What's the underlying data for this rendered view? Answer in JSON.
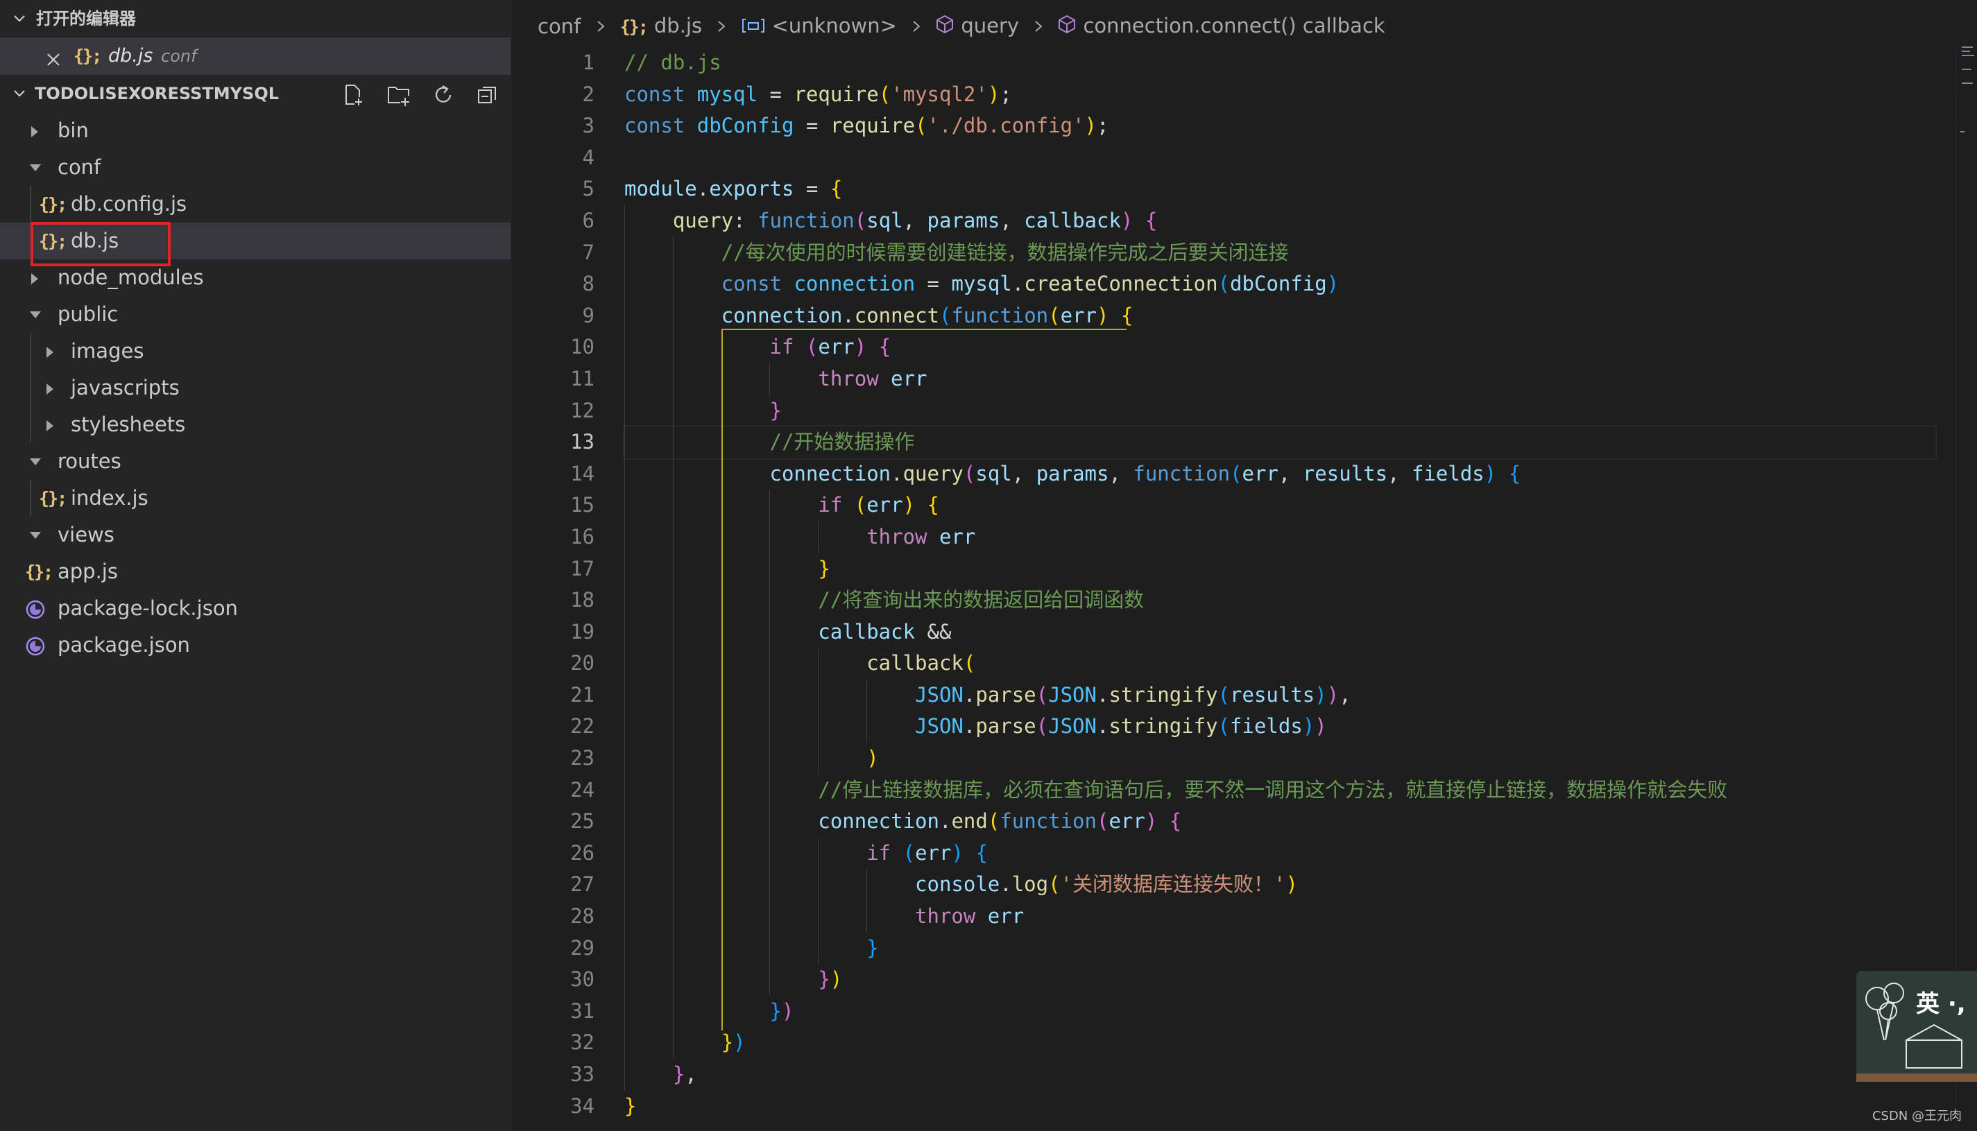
{
  "sidebar": {
    "open_editors_title": "打开的编辑器",
    "open_editor_file": "db.js",
    "open_editor_dir": "conf",
    "project_title": "TODOLISEXORESSTMYSQL",
    "tree": [
      {
        "label": "bin",
        "kind": "folder",
        "expanded": false
      },
      {
        "label": "conf",
        "kind": "folder",
        "expanded": true
      },
      {
        "label": "db.config.js",
        "kind": "js"
      },
      {
        "label": "db.js",
        "kind": "js",
        "active": true
      },
      {
        "label": "node_modules",
        "kind": "folder",
        "expanded": false
      },
      {
        "label": "public",
        "kind": "folder",
        "expanded": true
      },
      {
        "label": "images",
        "kind": "folder",
        "expanded": false
      },
      {
        "label": "javascripts",
        "kind": "folder",
        "expanded": false
      },
      {
        "label": "stylesheets",
        "kind": "folder",
        "expanded": false
      },
      {
        "label": "routes",
        "kind": "folder",
        "expanded": true
      },
      {
        "label": "index.js",
        "kind": "js"
      },
      {
        "label": "views",
        "kind": "folder",
        "expanded": true
      },
      {
        "label": "app.js",
        "kind": "js"
      },
      {
        "label": "package-lock.json",
        "kind": "json"
      },
      {
        "label": "package.json",
        "kind": "json"
      }
    ]
  },
  "breadcrumb": {
    "dir": "conf",
    "file": "db.js",
    "symbol1": "<unknown>",
    "symbol2": "query",
    "symbol3": "connection.connect() callback"
  },
  "editor": {
    "current_line": 13,
    "lines": [
      [
        [
          "com",
          "// db.js"
        ]
      ],
      [
        [
          "kw",
          "const "
        ],
        [
          "const",
          "mysql"
        ],
        [
          "txt",
          " = "
        ],
        [
          "fn",
          "require"
        ],
        [
          "b1",
          "("
        ],
        [
          "str",
          "'mysql2'"
        ],
        [
          "b1",
          ")"
        ],
        [
          "txt",
          ";"
        ]
      ],
      [
        [
          "kw",
          "const "
        ],
        [
          "const",
          "dbConfig"
        ],
        [
          "txt",
          " = "
        ],
        [
          "fn",
          "require"
        ],
        [
          "b1",
          "("
        ],
        [
          "str",
          "'./db.config'"
        ],
        [
          "b1",
          ")"
        ],
        [
          "txt",
          ";"
        ]
      ],
      [],
      [
        [
          "var",
          "module"
        ],
        [
          "txt",
          "."
        ],
        [
          "var",
          "exports"
        ],
        [
          "txt",
          " = "
        ],
        [
          "b1",
          "{"
        ]
      ],
      [
        [
          "txt",
          "    "
        ],
        [
          "fn",
          "query"
        ],
        [
          "txt",
          ": "
        ],
        [
          "kw",
          "function"
        ],
        [
          "b2",
          "("
        ],
        [
          "var",
          "sql"
        ],
        [
          "txt",
          ", "
        ],
        [
          "var",
          "params"
        ],
        [
          "txt",
          ", "
        ],
        [
          "var",
          "callback"
        ],
        [
          "b2",
          ")"
        ],
        [
          "txt",
          " "
        ],
        [
          "b2",
          "{"
        ]
      ],
      [
        [
          "txt",
          "        "
        ],
        [
          "com",
          "//每次使用的时候需要创建链接，数据操作完成之后要关闭连接"
        ]
      ],
      [
        [
          "txt",
          "        "
        ],
        [
          "kw",
          "const "
        ],
        [
          "const",
          "connection"
        ],
        [
          "txt",
          " = "
        ],
        [
          "var",
          "mysql"
        ],
        [
          "txt",
          "."
        ],
        [
          "fn",
          "createConnection"
        ],
        [
          "b3",
          "("
        ],
        [
          "var",
          "dbConfig"
        ],
        [
          "b3",
          ")"
        ]
      ],
      [
        [
          "txt",
          "        "
        ],
        [
          "var",
          "connection"
        ],
        [
          "txt",
          "."
        ],
        [
          "fn",
          "connect"
        ],
        [
          "b3",
          "("
        ],
        [
          "kw",
          "function"
        ],
        [
          "b1",
          "("
        ],
        [
          "var",
          "err"
        ],
        [
          "b1",
          ")"
        ],
        [
          "txt",
          " "
        ],
        [
          "b1",
          "{"
        ]
      ],
      [
        [
          "txt",
          "            "
        ],
        [
          "ctl",
          "if "
        ],
        [
          "b2",
          "("
        ],
        [
          "var",
          "err"
        ],
        [
          "b2",
          ")"
        ],
        [
          "txt",
          " "
        ],
        [
          "b2",
          "{"
        ]
      ],
      [
        [
          "txt",
          "                "
        ],
        [
          "ctl",
          "throw "
        ],
        [
          "var",
          "err"
        ]
      ],
      [
        [
          "txt",
          "            "
        ],
        [
          "b2",
          "}"
        ]
      ],
      [
        [
          "txt",
          "            "
        ],
        [
          "com",
          "//开始数据操作"
        ]
      ],
      [
        [
          "txt",
          "            "
        ],
        [
          "var",
          "connection"
        ],
        [
          "txt",
          "."
        ],
        [
          "fn",
          "query"
        ],
        [
          "b2",
          "("
        ],
        [
          "var",
          "sql"
        ],
        [
          "txt",
          ", "
        ],
        [
          "var",
          "params"
        ],
        [
          "txt",
          ", "
        ],
        [
          "kw",
          "function"
        ],
        [
          "b3",
          "("
        ],
        [
          "var",
          "err"
        ],
        [
          "txt",
          ", "
        ],
        [
          "var",
          "results"
        ],
        [
          "txt",
          ", "
        ],
        [
          "var",
          "fields"
        ],
        [
          "b3",
          ")"
        ],
        [
          "txt",
          " "
        ],
        [
          "b3",
          "{"
        ]
      ],
      [
        [
          "txt",
          "                "
        ],
        [
          "ctl",
          "if "
        ],
        [
          "b1",
          "("
        ],
        [
          "var",
          "err"
        ],
        [
          "b1",
          ")"
        ],
        [
          "txt",
          " "
        ],
        [
          "b1",
          "{"
        ]
      ],
      [
        [
          "txt",
          "                    "
        ],
        [
          "ctl",
          "throw "
        ],
        [
          "var",
          "err"
        ]
      ],
      [
        [
          "txt",
          "                "
        ],
        [
          "b1",
          "}"
        ]
      ],
      [
        [
          "txt",
          "                "
        ],
        [
          "com",
          "//将查询出来的数据返回给回调函数"
        ]
      ],
      [
        [
          "txt",
          "                "
        ],
        [
          "var",
          "callback"
        ],
        [
          "txt",
          " &&"
        ]
      ],
      [
        [
          "txt",
          "                    "
        ],
        [
          "fn",
          "callback"
        ],
        [
          "b1",
          "("
        ]
      ],
      [
        [
          "txt",
          "                        "
        ],
        [
          "const",
          "JSON"
        ],
        [
          "txt",
          "."
        ],
        [
          "fn",
          "parse"
        ],
        [
          "b2",
          "("
        ],
        [
          "const",
          "JSON"
        ],
        [
          "txt",
          "."
        ],
        [
          "fn",
          "stringify"
        ],
        [
          "b3",
          "("
        ],
        [
          "var",
          "results"
        ],
        [
          "b3",
          ")"
        ],
        [
          "b2",
          ")"
        ],
        [
          "txt",
          ","
        ]
      ],
      [
        [
          "txt",
          "                        "
        ],
        [
          "const",
          "JSON"
        ],
        [
          "txt",
          "."
        ],
        [
          "fn",
          "parse"
        ],
        [
          "b2",
          "("
        ],
        [
          "const",
          "JSON"
        ],
        [
          "txt",
          "."
        ],
        [
          "fn",
          "stringify"
        ],
        [
          "b3",
          "("
        ],
        [
          "var",
          "fields"
        ],
        [
          "b3",
          ")"
        ],
        [
          "b2",
          ")"
        ]
      ],
      [
        [
          "txt",
          "                    "
        ],
        [
          "b1",
          ")"
        ]
      ],
      [
        [
          "txt",
          "                "
        ],
        [
          "com",
          "//停止链接数据库，必须在查询语句后，要不然一调用这个方法，就直接停止链接，数据操作就会失败"
        ]
      ],
      [
        [
          "txt",
          "                "
        ],
        [
          "var",
          "connection"
        ],
        [
          "txt",
          "."
        ],
        [
          "fn",
          "end"
        ],
        [
          "b1",
          "("
        ],
        [
          "kw",
          "function"
        ],
        [
          "b2",
          "("
        ],
        [
          "var",
          "err"
        ],
        [
          "b2",
          ")"
        ],
        [
          "txt",
          " "
        ],
        [
          "b2",
          "{"
        ]
      ],
      [
        [
          "txt",
          "                    "
        ],
        [
          "ctl",
          "if "
        ],
        [
          "b3",
          "("
        ],
        [
          "var",
          "err"
        ],
        [
          "b3",
          ")"
        ],
        [
          "txt",
          " "
        ],
        [
          "b3",
          "{"
        ]
      ],
      [
        [
          "txt",
          "                        "
        ],
        [
          "var",
          "console"
        ],
        [
          "txt",
          "."
        ],
        [
          "fn",
          "log"
        ],
        [
          "b1",
          "("
        ],
        [
          "str",
          "'关闭数据库连接失败！'"
        ],
        [
          "b1",
          ")"
        ]
      ],
      [
        [
          "txt",
          "                        "
        ],
        [
          "ctl",
          "throw "
        ],
        [
          "var",
          "err"
        ]
      ],
      [
        [
          "txt",
          "                    "
        ],
        [
          "b3",
          "}"
        ]
      ],
      [
        [
          "txt",
          "                "
        ],
        [
          "b2",
          "}"
        ],
        [
          "b1",
          ")"
        ]
      ],
      [
        [
          "txt",
          "            "
        ],
        [
          "b3",
          "}"
        ],
        [
          "b2",
          ")"
        ]
      ],
      [
        [
          "txt",
          "        "
        ],
        [
          "b1",
          "}"
        ],
        [
          "b3",
          ")"
        ]
      ],
      [
        [
          "txt",
          "    "
        ],
        [
          "b2",
          "}"
        ],
        [
          "txt",
          ","
        ]
      ],
      [
        [
          "b1",
          "}"
        ]
      ]
    ]
  },
  "ime": {
    "label": "英 ·,"
  },
  "watermark": "CSDN @王元肉"
}
